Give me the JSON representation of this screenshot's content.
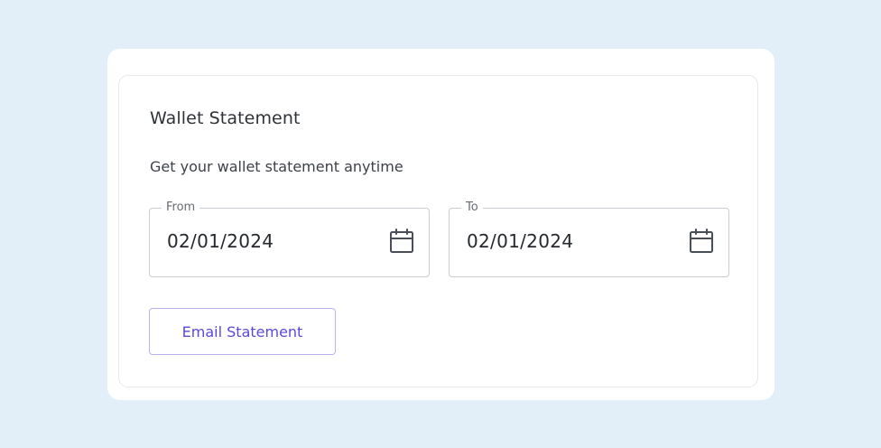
{
  "wallet_statement": {
    "title": "Wallet Statement",
    "subtitle": "Get your wallet statement anytime",
    "from_field": {
      "label": "From",
      "value": "02/01/2024",
      "icon": "calendar-icon"
    },
    "to_field": {
      "label": "To",
      "value": "02/01/2024",
      "icon": "calendar-icon"
    },
    "email_button_label": "Email Statement"
  },
  "colors": {
    "background": "#e2eff9",
    "card": "#ffffff",
    "accent": "#5a49d8",
    "button_border": "#b9b2ee",
    "field_border": "#c9cdd3"
  }
}
